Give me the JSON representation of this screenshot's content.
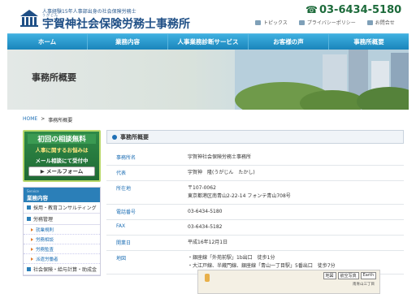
{
  "header": {
    "tagline": "人事経験15年人事部出身の社会保険労務士",
    "ruby": "うがじん",
    "office_name": "宇賀神社会保険労務士事務所",
    "phone": "03-6434-5180",
    "util_links": [
      "トピックス",
      "プライバシーポリシー",
      "お問合せ"
    ]
  },
  "nav": [
    "ホーム",
    "業務内容",
    "人事業務診断サービス",
    "お客様の声",
    "事務所概要"
  ],
  "hero": {
    "title": "事務所概要"
  },
  "breadcrumb": {
    "home": "HOME",
    "sep": ">",
    "current": "事務所概要"
  },
  "sidebar": {
    "consult": {
      "line1": "初回の相談無料",
      "line2": "人事に関するお悩みは",
      "line3": "メール相談にて受付中",
      "button": "メールフォーム"
    },
    "menu_head_en": "Service",
    "menu_head": "業務内容",
    "categories": [
      {
        "label": "採用・教育コンサルティング"
      },
      {
        "label": "労務管理"
      }
    ],
    "subs": [
      "就業規則",
      "労務相談",
      "労務監査",
      "派遣労働者"
    ],
    "last_category": "社会保険・給与計算・助成金"
  },
  "main": {
    "title": "事務所概要",
    "rows": [
      {
        "label": "事務所名",
        "value": [
          "宇賀神社会保険労務士事務所"
        ]
      },
      {
        "label": "代表",
        "value": [
          "宇賀神　隆(うがじん　たかし)"
        ]
      },
      {
        "label": "所在地",
        "value": [
          "〒107-0062",
          "東京都港区南青山2-22-14 フォンテ青山708号"
        ]
      },
      {
        "label": "電話番号",
        "value": [
          "03-6434-5180"
        ]
      },
      {
        "label": "FAX",
        "value": [
          "03-6434-5182"
        ]
      },
      {
        "label": "開業日",
        "value": [
          "平成16年12月1日"
        ]
      },
      {
        "label": "地図",
        "value": [
          "・銀座線「外苑前駅」1b出口　徒歩1分",
          "・大江戸線、半蔵門線、銀座線「青山一丁目駅」5番出口　徒歩7分"
        ]
      }
    ],
    "map": {
      "controls": [
        "地図",
        "航空写真",
        "Earth"
      ],
      "label": "南青山三丁目"
    }
  },
  "colors": {
    "nav_blue": "#1e8fc5",
    "brand_navy": "#1f4f86",
    "phone_green": "#1d6b3b",
    "consult_green": "#2f8a48"
  }
}
